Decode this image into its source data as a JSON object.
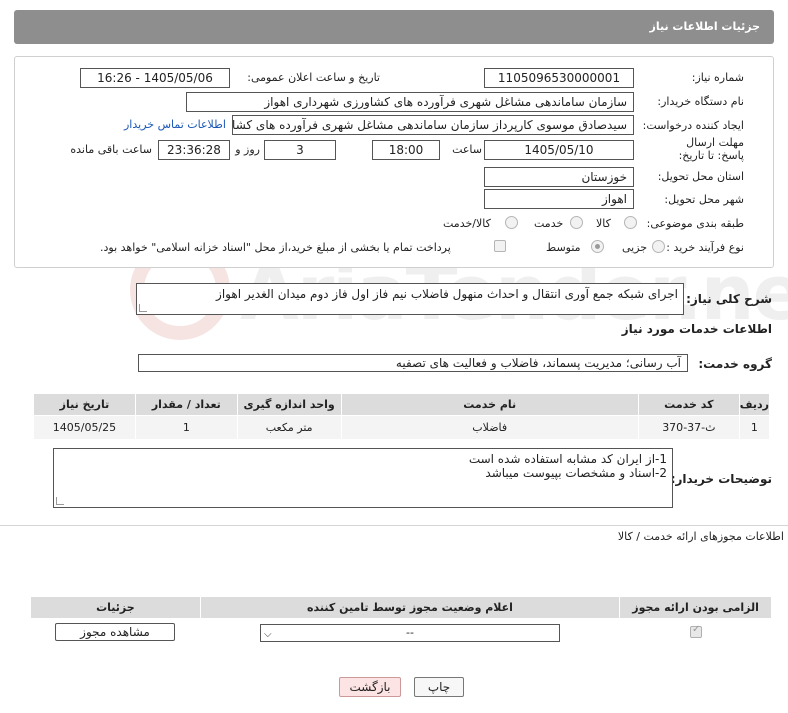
{
  "header": {
    "title": "جزئیات اطلاعات نیاز"
  },
  "form": {
    "need_number_label": "شماره نیاز:",
    "need_number": "1105096530000001",
    "announce_label": "تاریخ و ساعت اعلان عمومی:",
    "announce_value": "1405/05/06 - 16:26",
    "buyer_org_label": "نام دستگاه خریدار:",
    "buyer_org": "سازمان ساماندهی مشاغل شهری فرآورده های کشاورزی شهرداری اهواز",
    "requester_label": "ایجاد کننده درخواست:",
    "requester": "سیدصادق موسوی کارپرداز سازمان ساماندهی مشاغل شهری فرآورده های کشاورزی",
    "contact_link": "اطلاعات تماس خریدار",
    "deadline_label": "مهلت ارسال پاسخ: تا تاریخ:",
    "deadline_date": "1405/05/10",
    "time_label": "ساعت",
    "deadline_time": "18:00",
    "days_value": "3",
    "days_label": "روز و",
    "remaining_time": "23:36:28",
    "remaining_label": "ساعت باقی مانده",
    "province_label": "استان محل تحویل:",
    "province": "خوزستان",
    "city_label": "شهر محل تحویل:",
    "city": "اهواز",
    "category_label": "طبقه بندی موضوعی:",
    "category_options": [
      "کالا",
      "خدمت",
      "کالا/خدمت"
    ],
    "process_label": "نوع فرآیند خرید :",
    "process_options": [
      "جزیی",
      "متوسط"
    ],
    "payment_note": "پرداخت تمام یا بخشی از مبلغ خرید،از محل \"اسناد خزانه اسلامی\" خواهد بود."
  },
  "summary": {
    "label": "شرح کلی نیاز:",
    "text": "اجرای شبکه جمع آوری انتقال و احداث منهول فاضلاب نیم فاز اول فاز دوم میدان الغدیر اهواز"
  },
  "services": {
    "section_title": "اطلاعات خدمات مورد نیاز",
    "group_label": "گروه خدمت:",
    "group_value": "آب رسانی؛ مدیریت پسماند، فاضلاب و فعالیت های تصفیه",
    "columns": [
      "ردیف",
      "کد خدمت",
      "نام خدمت",
      "واحد اندازه گیری",
      "تعداد / مقدار",
      "تاریخ نیاز"
    ],
    "rows": [
      [
        "1",
        "ث-37-370",
        "فاضلاب",
        "متر مکعب",
        "1",
        "1405/05/25"
      ]
    ]
  },
  "buyer_notes": {
    "label": "توضیحات خریدار:",
    "line1": "1-از ایران کد مشابه استفاده شده است",
    "line2": "2-اسناد و مشخصات بپیوست میباشد"
  },
  "permits": {
    "title": "اطلاعات مجوزهای ارائه خدمت / کالا",
    "columns": [
      "الزامی بودن ارائه مجوز",
      "اعلام وضعیت مجوز توسط تامین کننده",
      "جزئیات"
    ],
    "select_value": "--",
    "view_button": "مشاهده مجوز"
  },
  "actions": {
    "print": "چاپ",
    "back": "بازگشت"
  }
}
